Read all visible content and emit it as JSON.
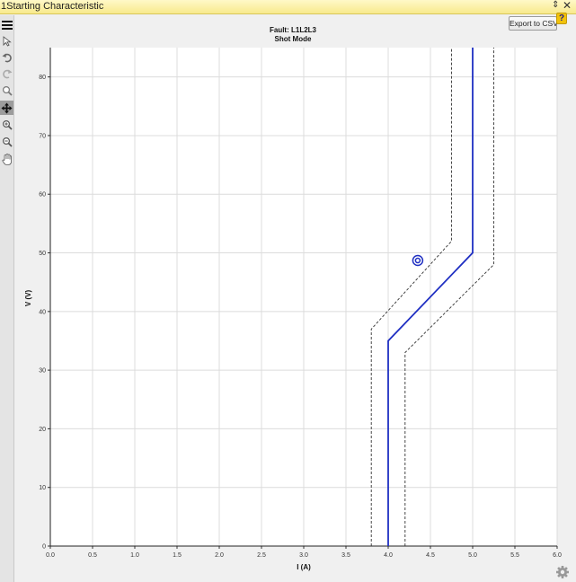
{
  "window": {
    "title": "1Starting Characteristic",
    "pin_glyph": "⇕",
    "close_glyph": "✕"
  },
  "toolbar": {
    "items": [
      {
        "icon": "menu-icon",
        "active": false
      },
      {
        "icon": "pointer-icon",
        "active": false
      },
      {
        "icon": "undo-icon",
        "active": false
      },
      {
        "icon": "redo-icon",
        "active": false
      },
      {
        "icon": "zoom-icon",
        "active": false
      },
      {
        "icon": "pan-move-icon",
        "active": true
      },
      {
        "icon": "zoom-in-icon",
        "active": false
      },
      {
        "icon": "zoom-out-icon",
        "active": false
      },
      {
        "icon": "hand-icon",
        "active": false
      }
    ]
  },
  "buttons": {
    "export_label": "Export to CSV",
    "help_label": "?"
  },
  "colors": {
    "characteristic": "#1f2fc2",
    "tolerance": "#333333",
    "grid": "#dcdcdc",
    "plot_bg": "#ffffff",
    "marker": "#1f2fc2"
  },
  "chart_data": {
    "type": "line",
    "title": "Fault: L1L2L3",
    "subtitle": "Shot Mode",
    "xlabel": "I (A)",
    "ylabel": "V (V)",
    "xlim": [
      0,
      6
    ],
    "ylim": [
      0,
      85
    ],
    "x_ticks": [
      "0.0",
      "0.5",
      "1.0",
      "1.5",
      "2.0",
      "2.5",
      "3.0",
      "3.5",
      "4.0",
      "4.5",
      "5.0",
      "5.5",
      "6.0"
    ],
    "y_ticks": [
      "0",
      "10",
      "20",
      "30",
      "40",
      "50",
      "60",
      "70",
      "80"
    ],
    "grid": true,
    "legend": "none",
    "series": [
      {
        "style": "solid",
        "points": [
          [
            4.0,
            0
          ],
          [
            4.0,
            35
          ],
          [
            5.0,
            50
          ],
          [
            5.0,
            85
          ]
        ]
      },
      {
        "style": "dashed",
        "points": [
          [
            3.8,
            0
          ],
          [
            3.8,
            37
          ],
          [
            4.75,
            52
          ],
          [
            4.75,
            85
          ]
        ]
      },
      {
        "style": "dashed",
        "points": [
          [
            4.2,
            0
          ],
          [
            4.2,
            33
          ],
          [
            5.25,
            48
          ],
          [
            5.25,
            85
          ]
        ]
      }
    ],
    "test_points": [
      {
        "x": 4.35,
        "y": 48.7
      }
    ]
  }
}
